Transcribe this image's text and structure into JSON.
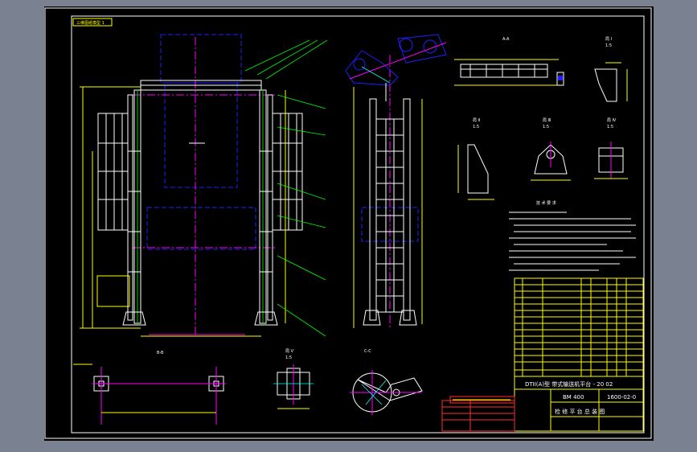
{
  "drawing": {
    "tab_label": "三维图纸模型 1",
    "section_bb": "B-B",
    "section_cc": "C-C",
    "view_aa": "A-A",
    "view_aa_scale": "1:5",
    "view_b1": "局 Ⅰ",
    "view_b1_scale": "1:5",
    "view_b2": "局 Ⅱ",
    "view_b2_scale": "1:5",
    "view_b3": "局 Ⅲ",
    "view_b3_scale": "1:5",
    "view_b4": "局 Ⅳ",
    "view_b4_scale": "1:5",
    "view_b5": "局 Ⅴ",
    "view_b5_scale": "1:5",
    "tech_title": "技 术 要 求",
    "title_main": "DTII(A)型 带式输送机平台 - 20 02",
    "model": "BM 400",
    "drawing_no": "1600-02-0",
    "title_sub": "检 修 平 台 总 装 图"
  }
}
